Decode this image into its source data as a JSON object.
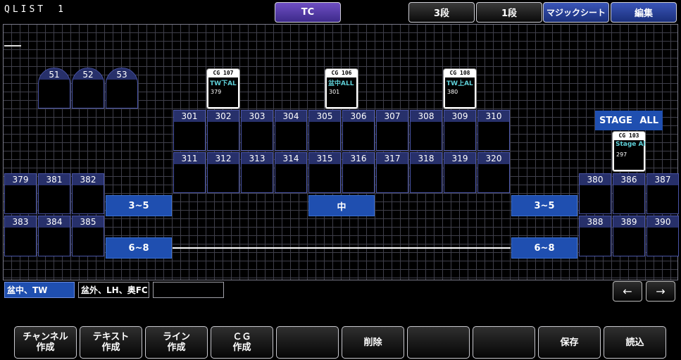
{
  "title": "QLIST　1",
  "top_buttons": [
    "TC",
    "3段",
    "1段",
    "マジックシート",
    "編集"
  ],
  "arch_cells": [
    "51",
    "52",
    "53"
  ],
  "row_upper": [
    "301",
    "302",
    "303",
    "304",
    "305",
    "306",
    "307",
    "308",
    "309",
    "310"
  ],
  "row_lower": [
    "311",
    "312",
    "313",
    "314",
    "315",
    "316",
    "317",
    "318",
    "319",
    "320"
  ],
  "left_top": [
    "379",
    "381",
    "382"
  ],
  "left_bottom": [
    "383",
    "384",
    "385"
  ],
  "right_top": [
    "380",
    "386",
    "387"
  ],
  "right_bottom": [
    "388",
    "389",
    "390"
  ],
  "bars": {
    "left_upper": "3~5",
    "left_lower": "6~8",
    "center": "中",
    "right_upper": "3~5",
    "right_lower": "6~8"
  },
  "stage_all": {
    "left": "STAGE",
    "right": "ALL"
  },
  "cards": [
    {
      "cg": "CG 107",
      "name": "TW下AL",
      "num": "379"
    },
    {
      "cg": "CG 106",
      "name": "盆中ALL",
      "num": "301"
    },
    {
      "cg": "CG 108",
      "name": "TW上AL",
      "num": "380"
    },
    {
      "cg": "CG 103",
      "name": "Stage Al",
      "num": "297"
    }
  ],
  "tabs": [
    "盆中、TW",
    "盆外、LH、奥FC",
    ""
  ],
  "arrows": {
    "left": "←",
    "right": "→"
  },
  "function_buttons": [
    "チャンネル\n作成",
    "テキスト\n作成",
    "ライン\n作成",
    "ＣＧ\n作成",
    "",
    "削除",
    "",
    "",
    "保存",
    "読込"
  ],
  "colors": {
    "accent_blue": "#1f4fb0",
    "label_navy": "#27306a",
    "cyan_text": "#5fd0d8",
    "purple": "#5a3fb0"
  }
}
